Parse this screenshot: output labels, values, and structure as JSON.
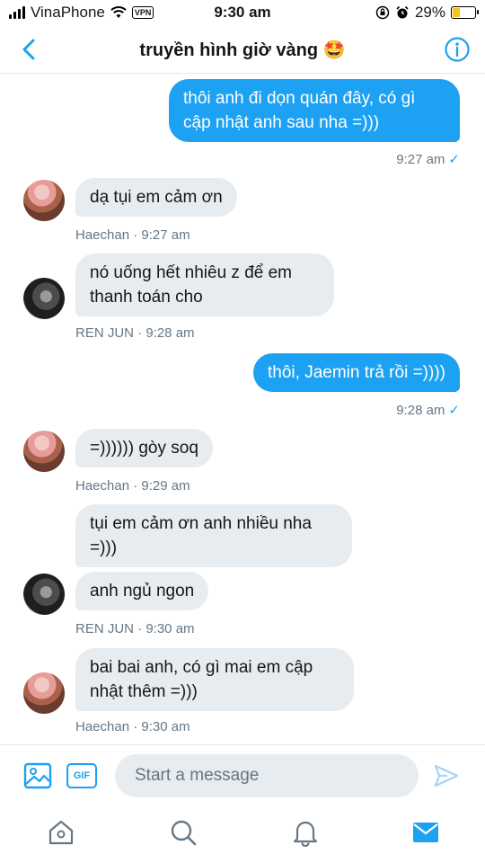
{
  "status_bar": {
    "carrier": "VinaPhone",
    "vpn": "VPN",
    "time": "9:30 am",
    "battery": "29%",
    "battery_level": 0.29
  },
  "header": {
    "title": "truyền hình giờ vàng 🤩"
  },
  "messages": [
    {
      "type": "out",
      "text": "thôi anh đi dọn quán đây, có gì cập nhật anh sau nha =)))",
      "meta": "9:27 am"
    },
    {
      "type": "in",
      "sender": "Haechan",
      "text": "dạ tụi em cảm ơn",
      "meta": "Haechan · 9:27 am"
    },
    {
      "type": "in",
      "sender": "REN JUN",
      "text": "nó uống hết nhiêu z để em thanh toán cho",
      "meta": "REN JUN · 9:28 am"
    },
    {
      "type": "out",
      "text": "thôi, Jaemin trả rồi =))))",
      "meta": "9:28 am"
    },
    {
      "type": "in",
      "sender": "Haechan",
      "text": "=)))))) gòy soq",
      "meta": "Haechan · 9:29 am"
    },
    {
      "type": "in",
      "sender": "REN JUN",
      "text": "tụi em cảm ơn anh nhiều nha =)))"
    },
    {
      "type": "in",
      "sender": "REN JUN",
      "text": "anh ngủ ngon",
      "meta": "REN JUN · 9:30 am"
    },
    {
      "type": "in",
      "sender": "Haechan",
      "text": "bai bai anh, có gì mai em cập nhật thêm =)))",
      "meta": "Haechan · 9:30 am"
    }
  ],
  "composer": {
    "gif_label": "GIF",
    "placeholder": "Start a message"
  },
  "tabbar": {
    "icons": [
      "home-icon",
      "search-icon",
      "notifications-icon",
      "messages-icon"
    ],
    "accent": "#1da1f2"
  }
}
